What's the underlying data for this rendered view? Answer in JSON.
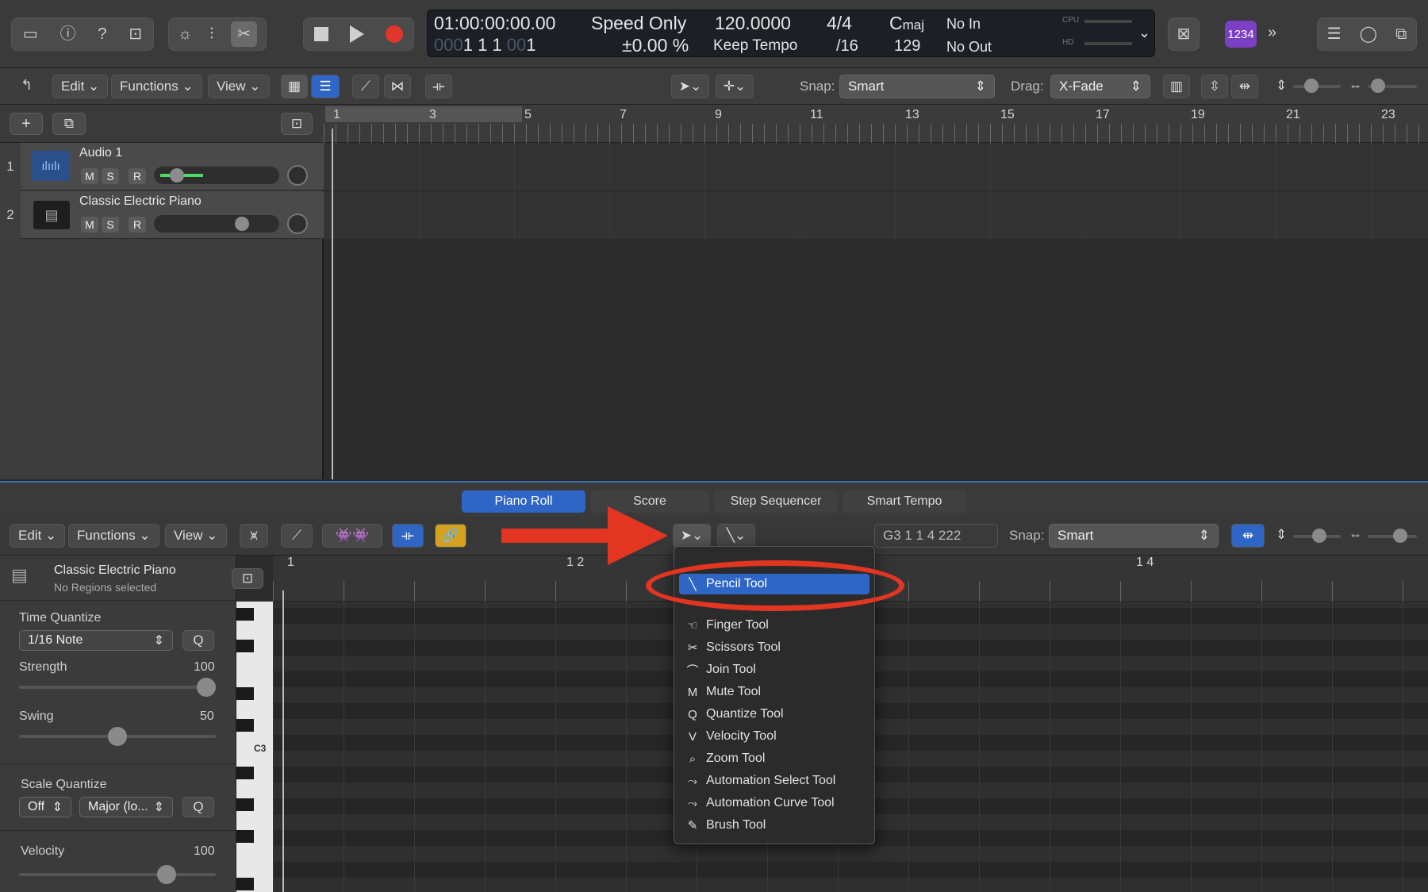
{
  "transport": {
    "time": "01:00:00:00.00",
    "bars_bright": "1 1 1",
    "bars_dim_a": "000",
    "bars_dim_b": "00",
    "bars_last": "1",
    "mode": "Speed Only",
    "offset": "±0.00 %",
    "tempo": "120.0000",
    "tempo_mode": "Keep Tempo",
    "signature": "4/4",
    "division": "/16",
    "key": "C",
    "key_mode": "maj",
    "key_value": "129",
    "input": "No In",
    "output": "No Out",
    "cpu_label": "CPU",
    "hd_label": "HD",
    "badge": "1234"
  },
  "arrange_toolbar": {
    "edit": "Edit",
    "functions": "Functions",
    "view": "View",
    "snap_label": "Snap:",
    "snap_value": "Smart",
    "drag_label": "Drag:",
    "drag_value": "X-Fade"
  },
  "ruler_numbers": [
    "1",
    "3",
    "5",
    "7",
    "9",
    "11",
    "13",
    "15",
    "17",
    "19",
    "21",
    "23"
  ],
  "tracks": [
    {
      "num": "1",
      "name": "Audio 1",
      "m": "M",
      "s": "S",
      "r": "R"
    },
    {
      "num": "2",
      "name": "Classic Electric Piano",
      "m": "M",
      "s": "S",
      "r": "R"
    }
  ],
  "editor_tabs": [
    "Piano Roll",
    "Score",
    "Step Sequencer",
    "Smart Tempo"
  ],
  "editor_toolbar": {
    "edit": "Edit",
    "functions": "Functions",
    "view": "View",
    "position": "G3   1 1 4 222",
    "snap_label": "Snap:",
    "snap_value": "Smart"
  },
  "inspector": {
    "region_name": "Classic Electric Piano",
    "region_sub": "No Regions selected",
    "time_quantize_label": "Time Quantize",
    "time_quantize_value": "1/16 Note",
    "q": "Q",
    "strength_label": "Strength",
    "strength_value": "100",
    "swing_label": "Swing",
    "swing_value": "50",
    "scale_quantize_label": "Scale Quantize",
    "scale_off": "Off",
    "scale_mode": "Major (lo...",
    "velocity_label": "Velocity",
    "velocity_value": "100",
    "c3": "C3"
  },
  "piano_ruler": [
    "1",
    "1 2",
    "1 4"
  ],
  "tool_menu": [
    {
      "icon": "╲",
      "label": "Pencil Tool",
      "selected": true
    },
    {
      "icon": "☜",
      "label": "Finger Tool"
    },
    {
      "icon": "✂",
      "label": "Scissors Tool"
    },
    {
      "icon": "⌒",
      "label": "Join Tool"
    },
    {
      "icon": "M",
      "label": "Mute Tool"
    },
    {
      "icon": "Q",
      "label": "Quantize Tool"
    },
    {
      "icon": "V",
      "label": "Velocity Tool"
    },
    {
      "icon": "⌕",
      "label": "Zoom Tool"
    },
    {
      "icon": "⤳",
      "label": "Automation Select Tool"
    },
    {
      "icon": "⤳",
      "label": "Automation Curve Tool"
    },
    {
      "icon": "✎",
      "label": "Brush Tool"
    }
  ],
  "colors": {
    "accent": "#2f66c6",
    "annotation": "#e23522",
    "record": "#e0362c",
    "badge": "#7b3fc4"
  }
}
